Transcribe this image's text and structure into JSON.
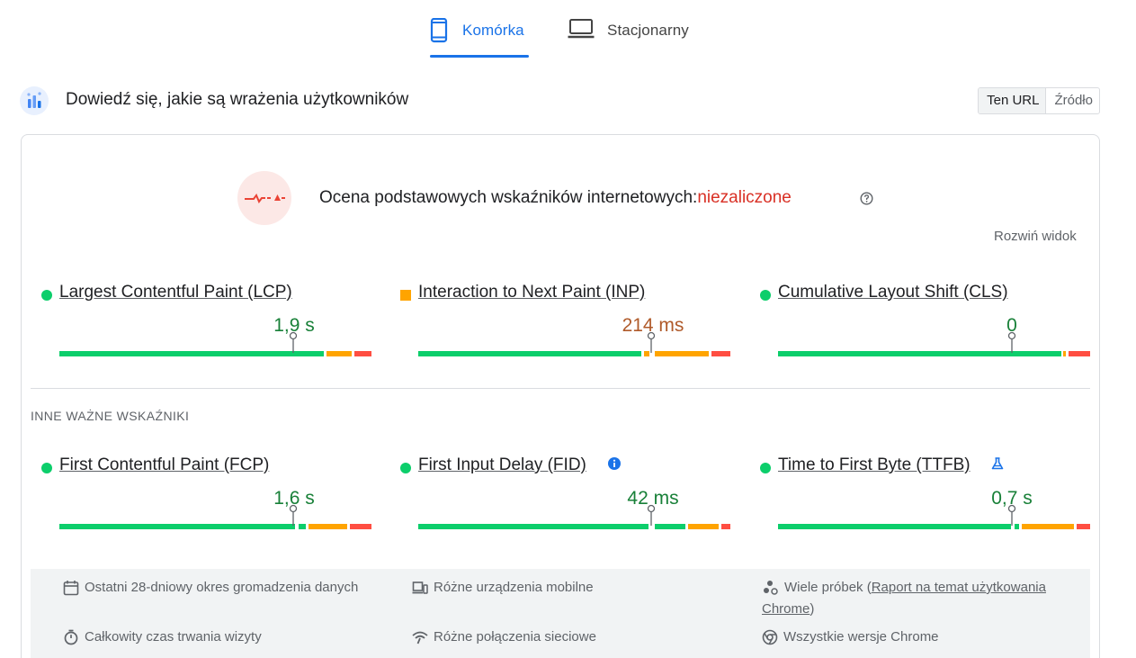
{
  "tabs": [
    {
      "label": "Komórka",
      "icon": "smartphone-icon",
      "active": true
    },
    {
      "label": "Stacjonarny",
      "icon": "laptop-icon",
      "active": false
    }
  ],
  "header": {
    "title": "Dowiedź się, jakie są wrażenia użytkowników",
    "toggle": {
      "active": "Ten URL",
      "inactive": "Źródło"
    }
  },
  "assessment": {
    "label": "Ocena podstawowych wskaźników internetowych:",
    "status": "niezaliczone",
    "expand": "Rozwiń widok"
  },
  "core_metrics": [
    {
      "name": "Largest Contentful Paint (LCP)",
      "value": "1,9 s",
      "rating": "good",
      "marker": "square-none"
    },
    {
      "name": "Interaction to Next Paint (INP)",
      "value": "214 ms",
      "rating": "needs-improvement"
    },
    {
      "name": "Cumulative Layout Shift (CLS)",
      "value": "0",
      "rating": "good"
    }
  ],
  "other_title": "INNE WAŻNE WSKAŹNIKI",
  "other_metrics": [
    {
      "name": "First Contentful Paint (FCP)",
      "value": "1,6 s",
      "rating": "good"
    },
    {
      "name": "First Input Delay (FID)",
      "value": "42 ms",
      "rating": "good",
      "badge": "info-icon"
    },
    {
      "name": "Time to First Byte (TTFB)",
      "value": "0,7 s",
      "rating": "good",
      "badge": "lab-flask-icon"
    }
  ],
  "info": {
    "period": "Ostatni 28-dniowy okres gromadzenia danych",
    "devices": "Różne urządzenia mobilne",
    "samples_prefix": "Wiele próbek (",
    "samples_link": "Raport na temat użytkowania Chrome",
    "samples_suffix": ")",
    "duration": "Całkowity czas trwania wizyty",
    "network": "Różne połączenia sieciowe",
    "chrome": "Wszystkie wersje Chrome"
  },
  "colors": {
    "accent": "#1a73e8",
    "good": "#0cce6b",
    "average": "#ffa400",
    "poor": "#ff4e42",
    "fail_text": "#d93025"
  }
}
